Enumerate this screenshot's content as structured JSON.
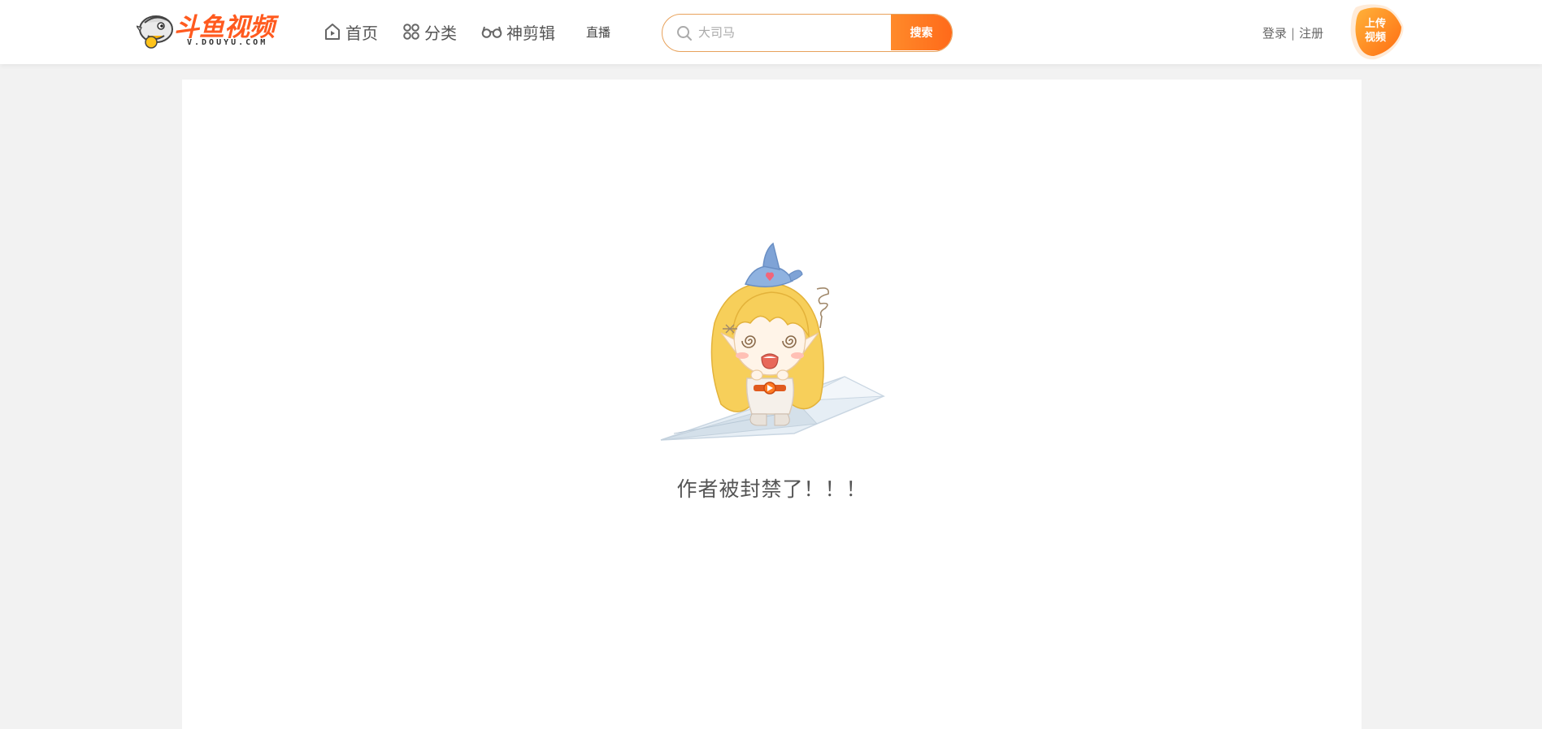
{
  "header": {
    "logo": {
      "text": "斗鱼视频",
      "subtext": "V.DOUYU.COM",
      "brand_color": "#ff5a1f"
    },
    "nav": [
      {
        "label": "首页",
        "icon": "home-icon"
      },
      {
        "label": "分类",
        "icon": "category-icon"
      },
      {
        "label": "神剪辑",
        "icon": "glasses-icon"
      },
      {
        "label": "直播",
        "icon": ""
      }
    ],
    "search": {
      "placeholder": "大司马",
      "button_label": "搜索",
      "icon": "search-icon",
      "accent_color": "#ff7a22"
    },
    "auth": {
      "login_label": "登录",
      "separator": "|",
      "register_label": "注册"
    },
    "upload": {
      "line1": "上传",
      "line2": "视频",
      "color": "#ff8a1c"
    }
  },
  "main": {
    "illustration": "mascot-on-paper-plane",
    "message": "作者被封禁了！！！"
  }
}
